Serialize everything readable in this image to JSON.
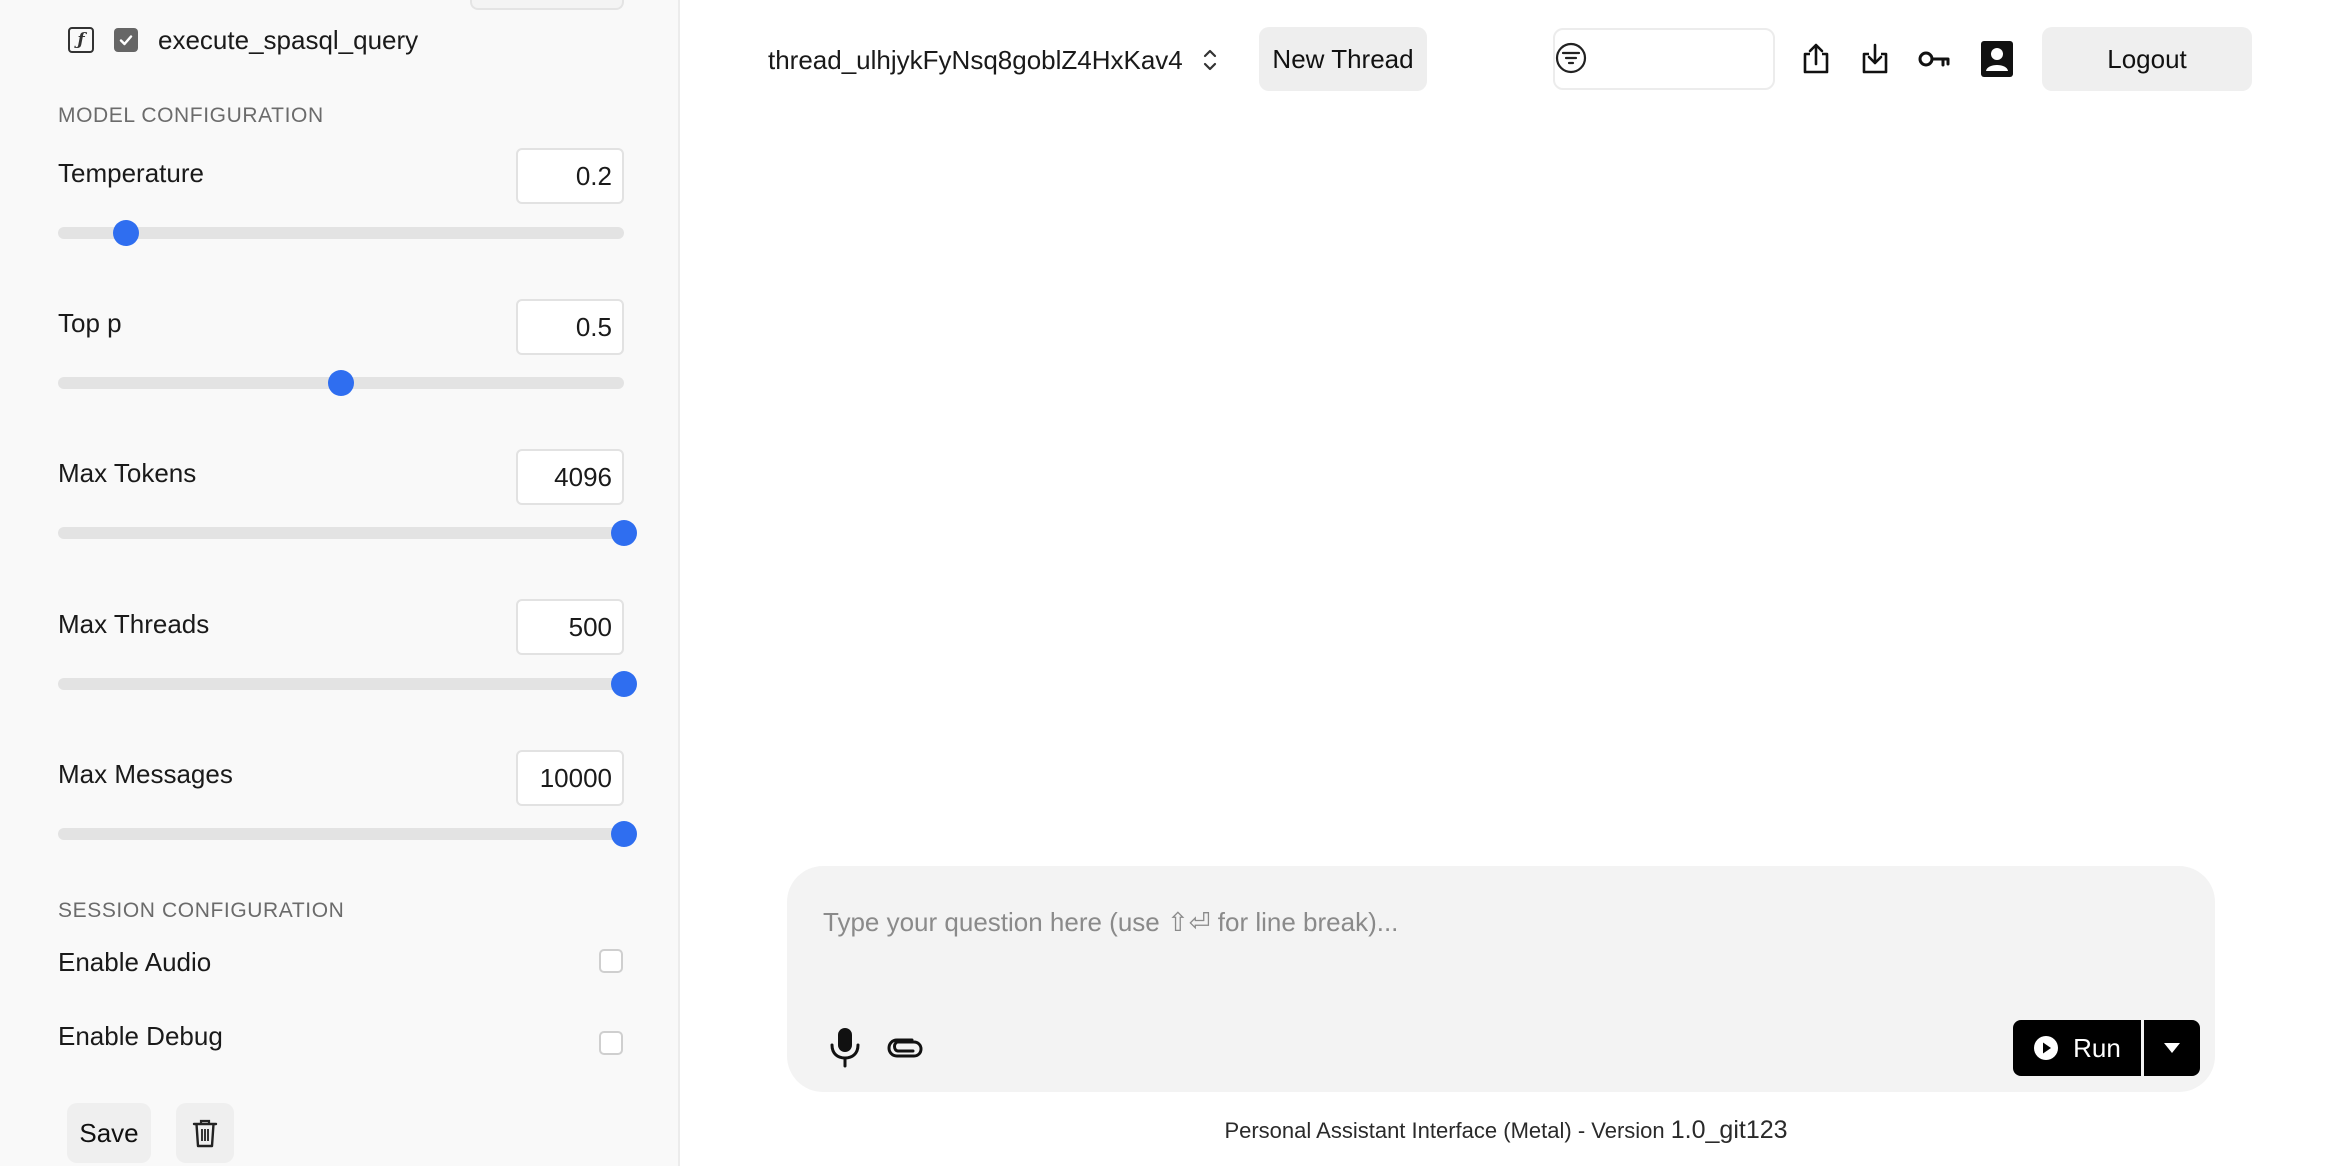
{
  "sidebar": {
    "tool": {
      "name": "execute_spasql_query",
      "checked": true
    },
    "model_config": {
      "heading": "MODEL CONFIGURATION",
      "params": [
        {
          "label": "Temperature",
          "value": "0.2",
          "fraction": 0.12
        },
        {
          "label": "Top p",
          "value": "0.5",
          "fraction": 0.5
        },
        {
          "label": "Max Tokens",
          "value": "4096",
          "fraction": 1.0
        },
        {
          "label": "Max Threads",
          "value": "500",
          "fraction": 1.0
        },
        {
          "label": "Max Messages",
          "value": "10000",
          "fraction": 1.0
        }
      ]
    },
    "session_config": {
      "heading": "SESSION CONFIGURATION",
      "toggles": [
        {
          "label": "Enable Audio",
          "checked": false
        },
        {
          "label": "Enable Debug",
          "checked": false
        }
      ]
    },
    "save_label": "Save"
  },
  "header": {
    "thread_name": "thread_ulhjykFyNsq8goblZ4HxKav4",
    "new_thread_label": "New Thread",
    "filter_value": "",
    "icons": [
      "upload-icon",
      "download-icon",
      "key-icon",
      "contact-icon"
    ],
    "logout_label": "Logout"
  },
  "composer": {
    "placeholder": "Type your question here (use ⇧⏎ for line break)...",
    "run_label": "Run"
  },
  "footer": {
    "text": "Personal Assistant Interface (Metal) - Version",
    "version": "1.0_git123"
  },
  "colors": {
    "accent": "#2f6ef0",
    "sidebar_bg": "#f9f9f9",
    "button_bg": "#efefef"
  }
}
